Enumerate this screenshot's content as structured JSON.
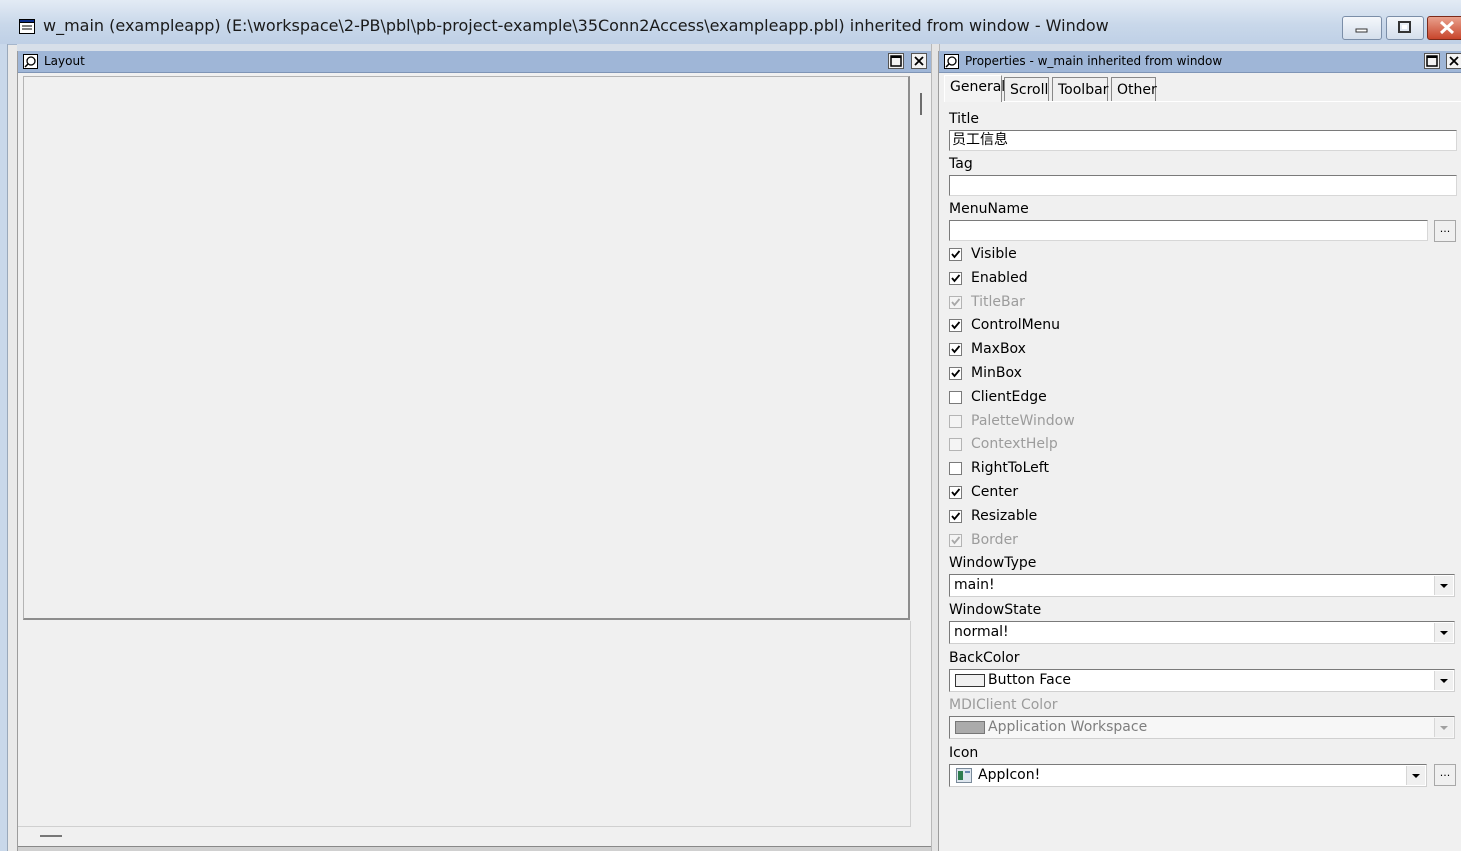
{
  "window": {
    "title": "w_main (exampleapp) (E:\\workspace\\2-PB\\pbl\\pb-project-example\\35Conn2Access\\exampleapp.pbl) inherited from window - Window"
  },
  "layout_panel": {
    "caption": "Layout"
  },
  "properties_panel": {
    "caption": "Properties - w_main inherited from window",
    "tabs": [
      {
        "label": "General",
        "active": true
      },
      {
        "label": "Scroll",
        "active": false
      },
      {
        "label": "Toolbar",
        "active": false
      },
      {
        "label": "Other",
        "active": false
      }
    ],
    "title_label": "Title",
    "title_value": "员工信息",
    "tag_label": "Tag",
    "tag_value": "",
    "menuname_label": "MenuName",
    "menuname_value": "",
    "browse_label": "...",
    "checkboxes": [
      {
        "label": "Visible",
        "checked": true,
        "enabled": true
      },
      {
        "label": "Enabled",
        "checked": true,
        "enabled": true
      },
      {
        "label": "TitleBar",
        "checked": true,
        "enabled": false
      },
      {
        "label": "ControlMenu",
        "checked": true,
        "enabled": true
      },
      {
        "label": "MaxBox",
        "checked": true,
        "enabled": true
      },
      {
        "label": "MinBox",
        "checked": true,
        "enabled": true
      },
      {
        "label": "ClientEdge",
        "checked": false,
        "enabled": true
      },
      {
        "label": "PaletteWindow",
        "checked": false,
        "enabled": false
      },
      {
        "label": "ContextHelp",
        "checked": false,
        "enabled": false
      },
      {
        "label": "RightToLeft",
        "checked": false,
        "enabled": true
      },
      {
        "label": "Center",
        "checked": true,
        "enabled": true
      },
      {
        "label": "Resizable",
        "checked": true,
        "enabled": true
      },
      {
        "label": "Border",
        "checked": true,
        "enabled": false
      }
    ],
    "windowtype_label": "WindowType",
    "windowtype_value": "main!",
    "windowstate_label": "WindowState",
    "windowstate_value": "normal!",
    "backcolor_label": "BackColor",
    "backcolor_value": "Button Face",
    "backcolor_swatch": "#f0f0f0",
    "mdiclient_label": "MDIClient Color",
    "mdiclient_value": "Application Workspace",
    "mdiclient_swatch": "#ababab",
    "icon_label": "Icon",
    "icon_value": "AppIcon!"
  },
  "colors": {
    "caption_bar": "#9fb6d7",
    "titlebar": "#c9d8ea",
    "close_button": "#c8452c"
  }
}
